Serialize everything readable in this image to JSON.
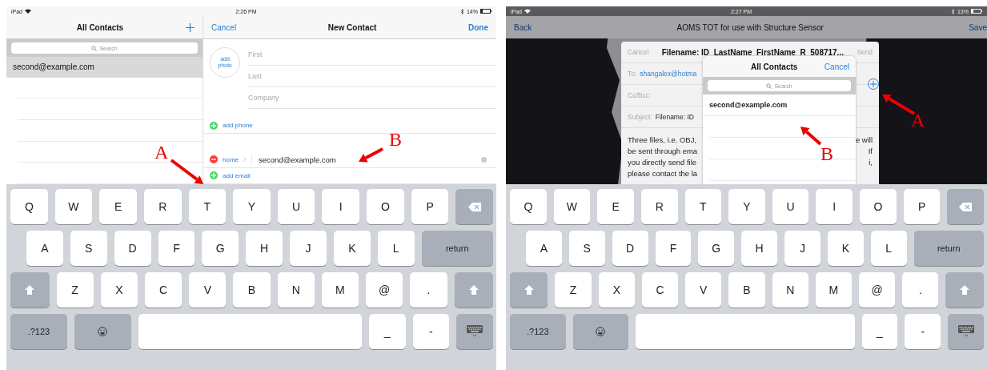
{
  "left_screen": {
    "status_bar": {
      "device": "iPad",
      "time": "2:26 PM",
      "battery": "14%"
    },
    "sidebar": {
      "title": "All Contacts",
      "search": {
        "placeholder": "Search"
      },
      "contacts": [
        {
          "name": "second@example.com",
          "selected": true
        }
      ]
    },
    "detail": {
      "cancel": "Cancel",
      "title": "New Contact",
      "done": "Done",
      "photo_button": "add\nphoto",
      "fields": [
        {
          "placeholder": "First"
        },
        {
          "placeholder": "Last"
        },
        {
          "placeholder": "Company"
        }
      ],
      "add_phone": "add phone",
      "email": {
        "label": "home",
        "value": "second@example.com"
      },
      "add_email": "add email"
    },
    "annotations": [
      {
        "label": "A"
      },
      {
        "label": "B"
      }
    ],
    "keyboard": {
      "rows": [
        {
          "keys": [
            {
              "kind": "char",
              "label": "Q"
            },
            {
              "kind": "char",
              "label": "W"
            },
            {
              "kind": "char",
              "label": "E"
            },
            {
              "kind": "char",
              "label": "R"
            },
            {
              "kind": "char",
              "label": "T"
            },
            {
              "kind": "char",
              "label": "Y"
            },
            {
              "kind": "char",
              "label": "U"
            },
            {
              "kind": "char",
              "label": "I"
            },
            {
              "kind": "char",
              "label": "O"
            },
            {
              "kind": "char",
              "label": "P"
            },
            {
              "kind": "delete"
            }
          ]
        },
        {
          "keys": [
            {
              "kind": "char",
              "label": "A"
            },
            {
              "kind": "char",
              "label": "S"
            },
            {
              "kind": "char",
              "label": "D"
            },
            {
              "kind": "char",
              "label": "F"
            },
            {
              "kind": "char",
              "label": "G"
            },
            {
              "kind": "char",
              "label": "H"
            },
            {
              "kind": "char",
              "label": "J"
            },
            {
              "kind": "char",
              "label": "K"
            },
            {
              "kind": "char",
              "label": "L"
            },
            {
              "kind": "return",
              "label": "return"
            }
          ]
        },
        {
          "keys": [
            {
              "kind": "shift"
            },
            {
              "kind": "char",
              "label": "Z"
            },
            {
              "kind": "char",
              "label": "X"
            },
            {
              "kind": "char",
              "label": "C"
            },
            {
              "kind": "char",
              "label": "V"
            },
            {
              "kind": "char",
              "label": "B"
            },
            {
              "kind": "char",
              "label": "N"
            },
            {
              "kind": "char",
              "label": "M"
            },
            {
              "kind": "char",
              "label": "@"
            },
            {
              "kind": "char",
              "label": "."
            },
            {
              "kind": "shift"
            }
          ]
        },
        {
          "keys": [
            {
              "kind": "mode",
              "label": ".?123"
            },
            {
              "kind": "emoji"
            },
            {
              "kind": "space"
            },
            {
              "kind": "char",
              "label": "_"
            },
            {
              "kind": "char",
              "label": "-"
            },
            {
              "kind": "hide"
            }
          ]
        }
      ]
    }
  },
  "right_screen": {
    "status_bar": {
      "device": "iPad",
      "time": "2:27 PM",
      "battery": "13%"
    },
    "nav": {
      "back": "Back",
      "title": "AOMS TOT for use with Structure Sensor",
      "save": "Save"
    },
    "compose": {
      "cancel": "Cancel",
      "title": "Filename: ID_LastName_FirstName_R_508717...",
      "send": "Send",
      "to_label": "To:",
      "to_value": "shangalex@hotma",
      "cc_label": "Cc/Bcc:",
      "subject_label": "Subject:",
      "subject_value": "Filename: ID",
      "body": [
        {
          "left": "Three files, i.e. OBJ,",
          "right": "e will"
        },
        {
          "left": "be sent through ema",
          "right": "If"
        },
        {
          "left": "you directly send file",
          "right": "i,"
        },
        {
          "left": "please contact the la"
        }
      ]
    },
    "popover": {
      "title": "All Contacts",
      "cancel": "Cancel",
      "search": {
        "placeholder": "Search"
      },
      "contacts": [
        {
          "name": "second@example.com"
        }
      ]
    },
    "annotations": [
      {
        "label": "A"
      },
      {
        "label": "B"
      }
    ],
    "keyboard": {
      "rows": [
        {
          "keys": [
            {
              "kind": "char",
              "label": "Q"
            },
            {
              "kind": "char",
              "label": "W"
            },
            {
              "kind": "char",
              "label": "E"
            },
            {
              "kind": "char",
              "label": "R"
            },
            {
              "kind": "char",
              "label": "T"
            },
            {
              "kind": "char",
              "label": "Y"
            },
            {
              "kind": "char",
              "label": "U"
            },
            {
              "kind": "char",
              "label": "I"
            },
            {
              "kind": "char",
              "label": "O"
            },
            {
              "kind": "char",
              "label": "P"
            },
            {
              "kind": "delete"
            }
          ]
        },
        {
          "keys": [
            {
              "kind": "char",
              "label": "A"
            },
            {
              "kind": "char",
              "label": "S"
            },
            {
              "kind": "char",
              "label": "D"
            },
            {
              "kind": "char",
              "label": "F"
            },
            {
              "kind": "char",
              "label": "G"
            },
            {
              "kind": "char",
              "label": "H"
            },
            {
              "kind": "char",
              "label": "J"
            },
            {
              "kind": "char",
              "label": "K"
            },
            {
              "kind": "char",
              "label": "L"
            },
            {
              "kind": "return",
              "label": "return"
            }
          ]
        },
        {
          "keys": [
            {
              "kind": "shift"
            },
            {
              "kind": "char",
              "label": "Z"
            },
            {
              "kind": "char",
              "label": "X"
            },
            {
              "kind": "char",
              "label": "C"
            },
            {
              "kind": "char",
              "label": "V"
            },
            {
              "kind": "char",
              "label": "B"
            },
            {
              "kind": "char",
              "label": "N"
            },
            {
              "kind": "char",
              "label": "M"
            },
            {
              "kind": "char",
              "label": "@"
            },
            {
              "kind": "char",
              "label": "."
            },
            {
              "kind": "shift"
            }
          ]
        },
        {
          "keys": [
            {
              "kind": "mode",
              "label": ".?123"
            },
            {
              "kind": "emoji"
            },
            {
              "kind": "space"
            },
            {
              "kind": "char",
              "label": "_"
            },
            {
              "kind": "char",
              "label": "-"
            },
            {
              "kind": "hide"
            }
          ]
        }
      ]
    }
  }
}
